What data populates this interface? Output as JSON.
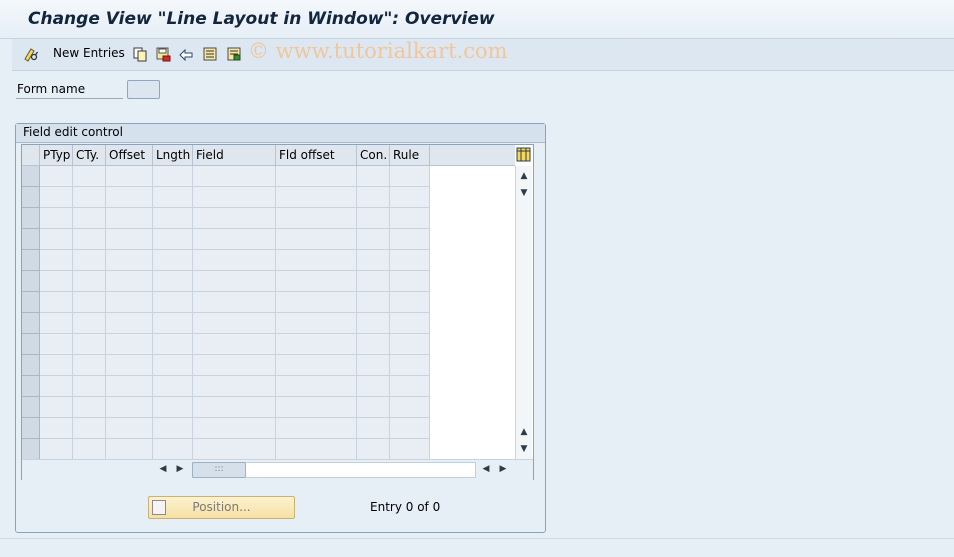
{
  "title": "Change View \"Line Layout in Window\": Overview",
  "toolbar": {
    "new_entries_label": "New Entries",
    "watermark": "© www.tutorialkart.com",
    "icons": [
      "edit-glasses-icon",
      "copy-icon",
      "save-red-icon",
      "undo-icon",
      "select-block-icon",
      "deselect-icon"
    ]
  },
  "form": {
    "label": "Form name",
    "value": ""
  },
  "group": {
    "title": "Field edit control"
  },
  "table": {
    "columns": [
      "PTyp",
      "CTy.",
      "Offset",
      "Lngth",
      "Field",
      "Fld offset",
      "Con.",
      "Rule"
    ],
    "row_count": 14
  },
  "footer": {
    "position_label": "Position...",
    "entry_text": "Entry 0 of 0"
  },
  "colors": {
    "accent": "#f6e1a4",
    "background": "#e6eef6",
    "title": "#12263d"
  }
}
